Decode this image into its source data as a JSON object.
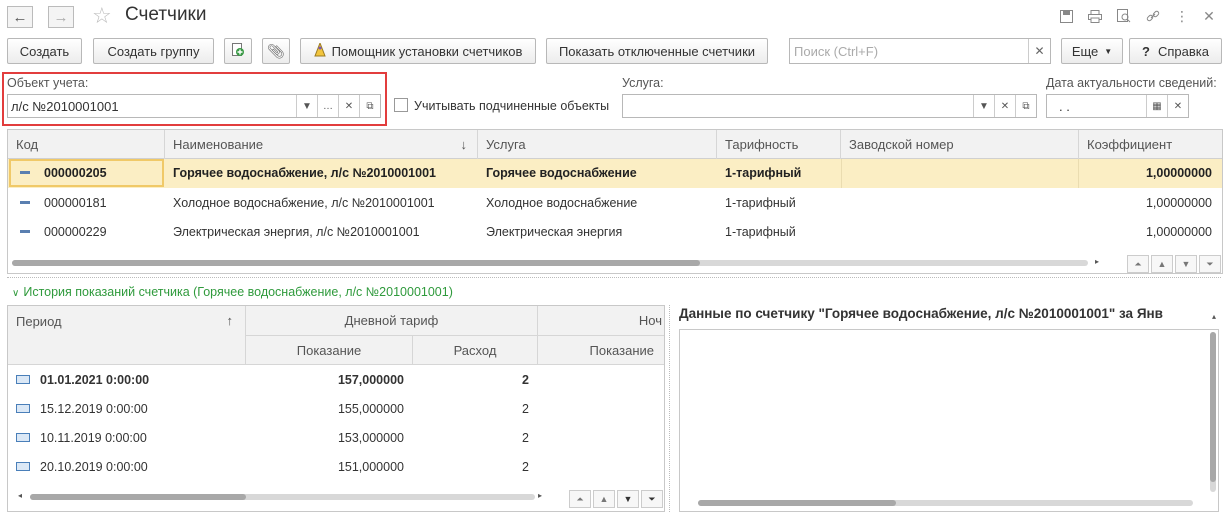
{
  "header": {
    "title": "Счетчики",
    "back_icon": "←",
    "forward_icon": "→"
  },
  "toolbar": {
    "create": "Создать",
    "create_group": "Создать группу",
    "install_wizard": "Помощник установки счетчиков",
    "show_disabled": "Показать отключенные счетчики",
    "search_placeholder": "Поиск (Ctrl+F)",
    "more": "Еще",
    "help": "Справка"
  },
  "filters": {
    "object_label": "Объект учета:",
    "object_value": "л/с №2010001001",
    "include_sub_label": "Учитывать подчиненные объекты",
    "service_label": "Услуга:",
    "service_value": "",
    "date_label": "Дата актуальности сведений:",
    "date_value": " .  ."
  },
  "meters_table": {
    "columns": [
      "Код",
      "Наименование",
      "Услуга",
      "Тарифность",
      "Заводской номер",
      "Коэффициент"
    ],
    "sort_indicator": "↓",
    "rows": [
      {
        "code": "000000205",
        "name": "Горячее водоснабжение, л/с №2010001001",
        "service": "Горячее водоснабжение",
        "tariff": "1-тарифный",
        "serial": "",
        "coef": "1,00000000"
      },
      {
        "code": "000000181",
        "name": "Холодное водоснабжение, л/с №2010001001",
        "service": "Холодное водоснабжение",
        "tariff": "1-тарифный",
        "serial": "",
        "coef": "1,00000000"
      },
      {
        "code": "000000229",
        "name": "Электрическая энергия, л/с №2010001001",
        "service": "Электрическая энергия",
        "tariff": "1-тарифный",
        "serial": "",
        "coef": "1,00000000"
      }
    ]
  },
  "history": {
    "title": "История показаний счетчика (Горячее водоснабжение, л/с №2010001001)",
    "col_period": "Период",
    "col_day_tariff": "Дневной тариф",
    "col_night_tariff": "Ноч",
    "col_reading": "Показание",
    "col_consumption": "Расход",
    "col_reading2": "Показание",
    "sort_indicator": "↑",
    "rows": [
      {
        "period": "01.01.2021 0:00:00",
        "reading": "157,000000",
        "consumption": "2"
      },
      {
        "period": "15.12.2019 0:00:00",
        "reading": "155,000000",
        "consumption": "2"
      },
      {
        "period": "10.11.2019 0:00:00",
        "reading": "153,000000",
        "consumption": "2"
      },
      {
        "period": "20.10.2019 0:00:00",
        "reading": "151,000000",
        "consumption": "2"
      }
    ]
  },
  "details": {
    "title": "Данные по счетчику \"Горячее водоснабжение, л/с №2010001001\" за Янв"
  }
}
